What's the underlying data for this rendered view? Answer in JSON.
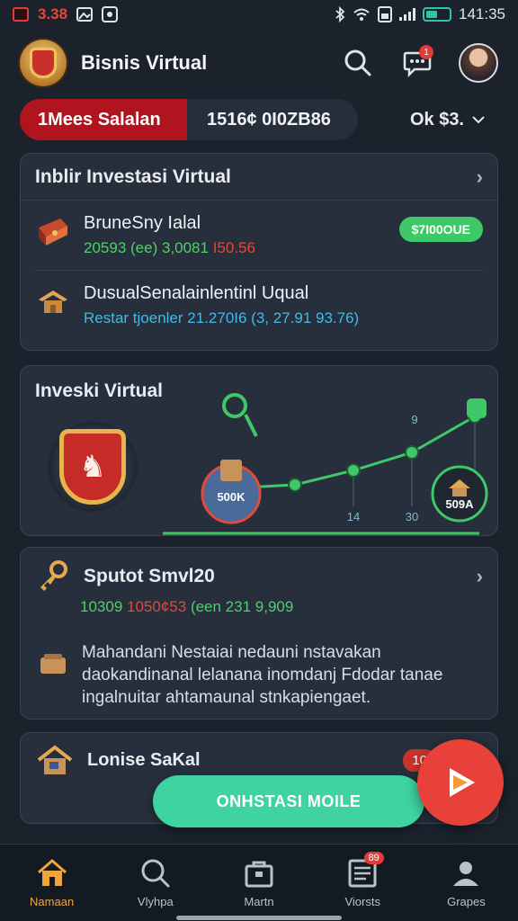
{
  "status_bar": {
    "left_text": "3.38",
    "time": "141:35"
  },
  "header": {
    "title": "Bisnis Virtual",
    "notif_count": "1"
  },
  "balance": {
    "label": "1Mees Salalan",
    "value": "1516¢ 0I0ZB86",
    "currency": "Ok $3."
  },
  "card_investments": {
    "title": "Inblir Investasi Virtual",
    "items": [
      {
        "title": "BruneSny Ialal",
        "sub_green": "20593 (ee) 3,0081",
        "sub_red": "I50.56",
        "tag": "$7I00OUE",
        "icon": "treasure-chest-icon"
      },
      {
        "title": "DusualSenalainlentinl Uqual",
        "sub_cyan": "Restar tjoenler 21.270I6 (3, 27.91 93.76)",
        "icon": "house-roof-icon"
      }
    ]
  },
  "card_chart": {
    "title": "Inveski Virtual",
    "start_label": "500K",
    "end_label": "509A",
    "x_labels": [
      "14",
      "30"
    ],
    "peak_label": "9"
  },
  "chart_data": {
    "type": "line",
    "title": "Inveski Virtual",
    "x": [
      "",
      "",
      "14",
      "30",
      ""
    ],
    "series": [
      {
        "values": [
          500,
          520,
          600,
          700,
          900
        ]
      }
    ]
  },
  "card_business": {
    "title": "Sputot Smvl20",
    "sub_green_a": "10309",
    "sub_red": "1050¢53",
    "sub_green_b": "(een 231 9,909",
    "description": "Mahandani Nestaiai nedauni nstavakan daokandinanal lelanana inomdanj Fdodar tanae ingalnuitar ahtamaunal stnkapiengaet.",
    "icon": "key-icon",
    "desc_icon": "wallet-icon"
  },
  "card_last": {
    "title": "Lonise SaKal",
    "badge": "10"
  },
  "cta": {
    "label": "ONHSTASI MOILE"
  },
  "nav": [
    {
      "label": "Namaan",
      "icon": "home-icon"
    },
    {
      "label": "Vlyhpa",
      "icon": "search-icon"
    },
    {
      "label": "Martn",
      "icon": "shop-icon"
    },
    {
      "label": "Viorsts",
      "icon": "report-icon",
      "badge": "89"
    },
    {
      "label": "Grapes",
      "icon": "profile-icon"
    }
  ],
  "colors": {
    "accent_red": "#b0141e",
    "accent_green": "#3ec868",
    "cta": "#3fd3a2",
    "fab": "#e8413a",
    "nav_active": "#f0a640"
  }
}
